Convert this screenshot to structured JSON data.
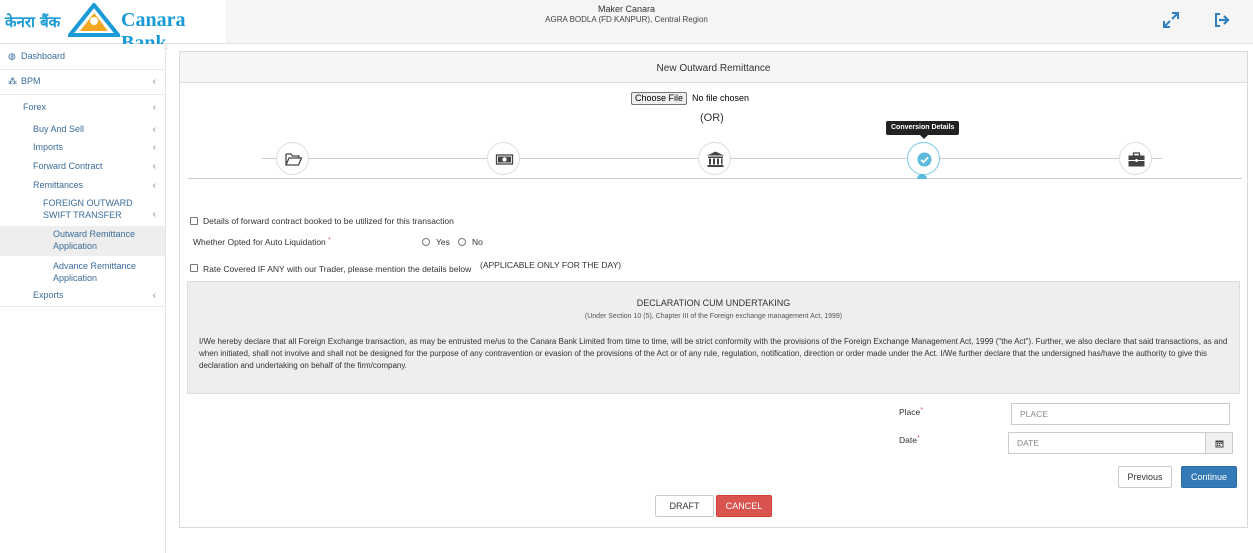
{
  "header": {
    "logo_hindi": "केनरा बैंक",
    "logo_text": "Canara Bank",
    "user": "Maker Canara",
    "branch": "AGRA BODLA (FD KANPUR),  Central Region",
    "icons": [
      "expand-icon",
      "logout-icon"
    ]
  },
  "sidebar": {
    "dashboard": "Dashboard",
    "bpm": "BPM",
    "forex": "Forex",
    "buy_and_sell": "Buy And Sell",
    "imports": "Imports",
    "forward_contract": "Forward Contract",
    "remittances": "Remittances",
    "fost_line1": "FOREIGN OUTWARD",
    "fost_line2": "SWIFT TRANSFER",
    "outward_line1": "Outward Remittance",
    "outward_line2": "Application",
    "advance_line1": "Advance Remittance",
    "advance_line2": "Application",
    "exports": "Exports",
    "chevron": "‹"
  },
  "panel": {
    "title": "New Outward Remittance",
    "file_button": "Choose File",
    "file_status": "No file chosen",
    "or_text": "(OR)",
    "tooltip": "Conversion Details",
    "steps": [
      "folder-open-icon",
      "money-icon",
      "bank-icon",
      "check-circle-icon",
      "briefcase-icon"
    ],
    "active_step": 4
  },
  "form": {
    "forward_contract_label": "Details of forward contract booked to be utilized for this transaction",
    "auto_liquidation_label": "Whether Opted for Auto Liquidation",
    "yes": "Yes",
    "no": "No",
    "rate_covered_label": "Rate Covered IF ANY with our Trader, please mention the details below",
    "rate_covered_note": "(APPLICABLE ONLY FOR THE DAY)",
    "required_mark": "*",
    "place_label": "Place",
    "place_placeholder": "PLACE",
    "date_label": "Date",
    "date_placeholder": "DATE"
  },
  "declaration": {
    "title": "DECLARATION CUM UNDERTAKING",
    "subtitle": "(Under Section 10 (5), Chapter III of the Foreign exchange management Act, 1999)",
    "body": "I/We hereby declare that all Foreign Exchange transaction, as may be entrusted me/us to the Canara Bank Limited from time to time, will be strict conformity with the provisions of the Foreign Exchange Management Act, 1999 (\"the Act\"). Further, we also declare that said transactions, as and when initiated, shall not involve and shall not be designed for the purpose of any contravention or evasion of the provisions of the Act or of any rule, regulation, notification, direction or order made under the Act. I/We further declare that the undersigned has/have the authority to give this declaration and undertaking on behalf of the firm/company."
  },
  "buttons": {
    "previous": "Previous",
    "continue": "Continue",
    "draft": "DRAFT",
    "cancel": "CANCEL"
  },
  "colors": {
    "brand": "#1a9ad6",
    "logo_yellow": "#f5a623",
    "link": "#3a6c9a",
    "primary": "#337ab7",
    "danger": "#d9534f"
  }
}
